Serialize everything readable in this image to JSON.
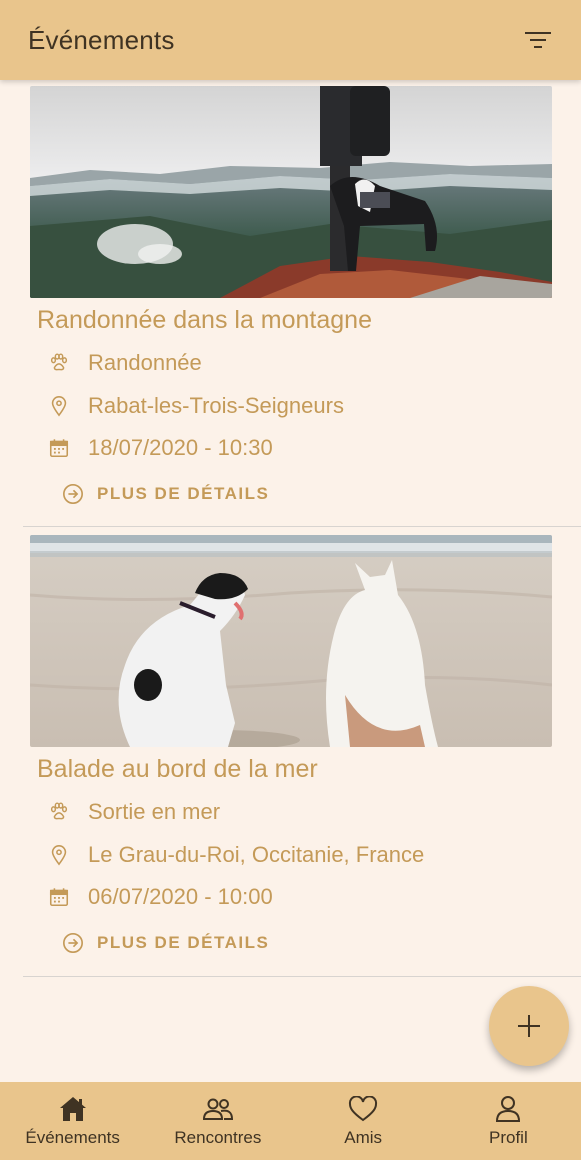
{
  "app_bar": {
    "title": "Événements",
    "filter_icon": "filter-icon"
  },
  "events": [
    {
      "title": "Randonnée dans la montagne",
      "image": "mountain-hiker-with-dog-photo",
      "activity_icon": "paw-icon",
      "activity": "Randonnée",
      "location_icon": "map-pin-icon",
      "location": "Rabat-les-Trois-Seigneurs",
      "date_icon": "calendar-icon",
      "date": "18/07/2020 - 10:30",
      "details_icon": "arrow-circle-right-icon",
      "details_label": "PLUS DE DÉTAILS"
    },
    {
      "title": "Balade au bord de la mer",
      "image": "two-dogs-on-beach-photo",
      "activity_icon": "paw-icon",
      "activity": "Sortie en mer",
      "location_icon": "map-pin-icon",
      "location": "Le Grau-du-Roi, Occitanie, France",
      "date_icon": "calendar-icon",
      "date": "06/07/2020 - 10:00",
      "details_icon": "arrow-circle-right-icon",
      "details_label": "PLUS DE DÉTAILS"
    }
  ],
  "fab": {
    "icon": "plus-icon"
  },
  "bottom_nav": [
    {
      "label": "Événements",
      "icon": "home-icon",
      "active": true
    },
    {
      "label": "Rencontres",
      "icon": "people-icon",
      "active": false
    },
    {
      "label": "Amis",
      "icon": "heart-icon",
      "active": false
    },
    {
      "label": "Profil",
      "icon": "person-icon",
      "active": false
    }
  ],
  "colors": {
    "bar": "#e9c58c",
    "background": "#fcf2e9",
    "accent_text": "#c49a58",
    "dark_text": "#3f3323"
  }
}
